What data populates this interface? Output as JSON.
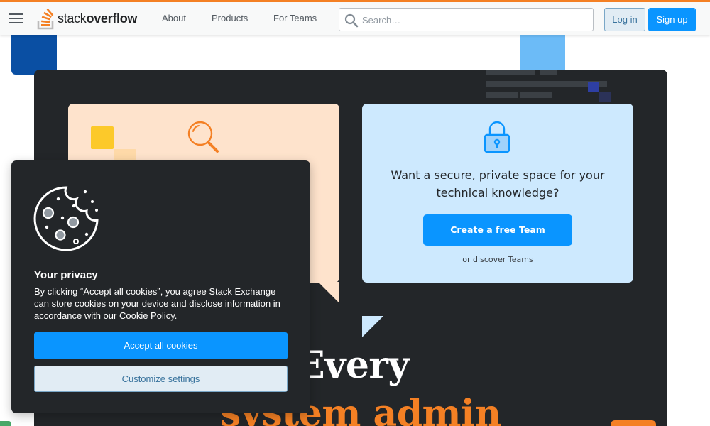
{
  "header": {
    "logo_word_light": "stack",
    "logo_word_bold": "overflow",
    "nav": [
      "About",
      "Products",
      "For Teams"
    ],
    "search_placeholder": "Search…",
    "login_label": "Log in",
    "signup_label": "Sign up"
  },
  "teams_card": {
    "text": "Want a secure, private space for your technical knowledge?",
    "button_label": "Create a free Team",
    "or_text": "or",
    "discover_link": "discover Teams"
  },
  "hero": {
    "headline_line1": "Every",
    "headline_line2": "system admin"
  },
  "cookie_banner": {
    "title": "Your privacy",
    "body_text": "By clicking “Accept all cookies”, you agree Stack Exchange can store cookies on your device and disclose information in accordance with our",
    "policy_link": "Cookie Policy",
    "body_end": ".",
    "accept_label": "Accept all cookies",
    "customize_label": "Customize settings"
  },
  "colors": {
    "brand_orange": "#f48024",
    "primary_blue": "#0a95ff",
    "hero_dark": "#232629",
    "teams_card_bg": "#cde9fe",
    "search_card_bg": "#fee3cc"
  }
}
